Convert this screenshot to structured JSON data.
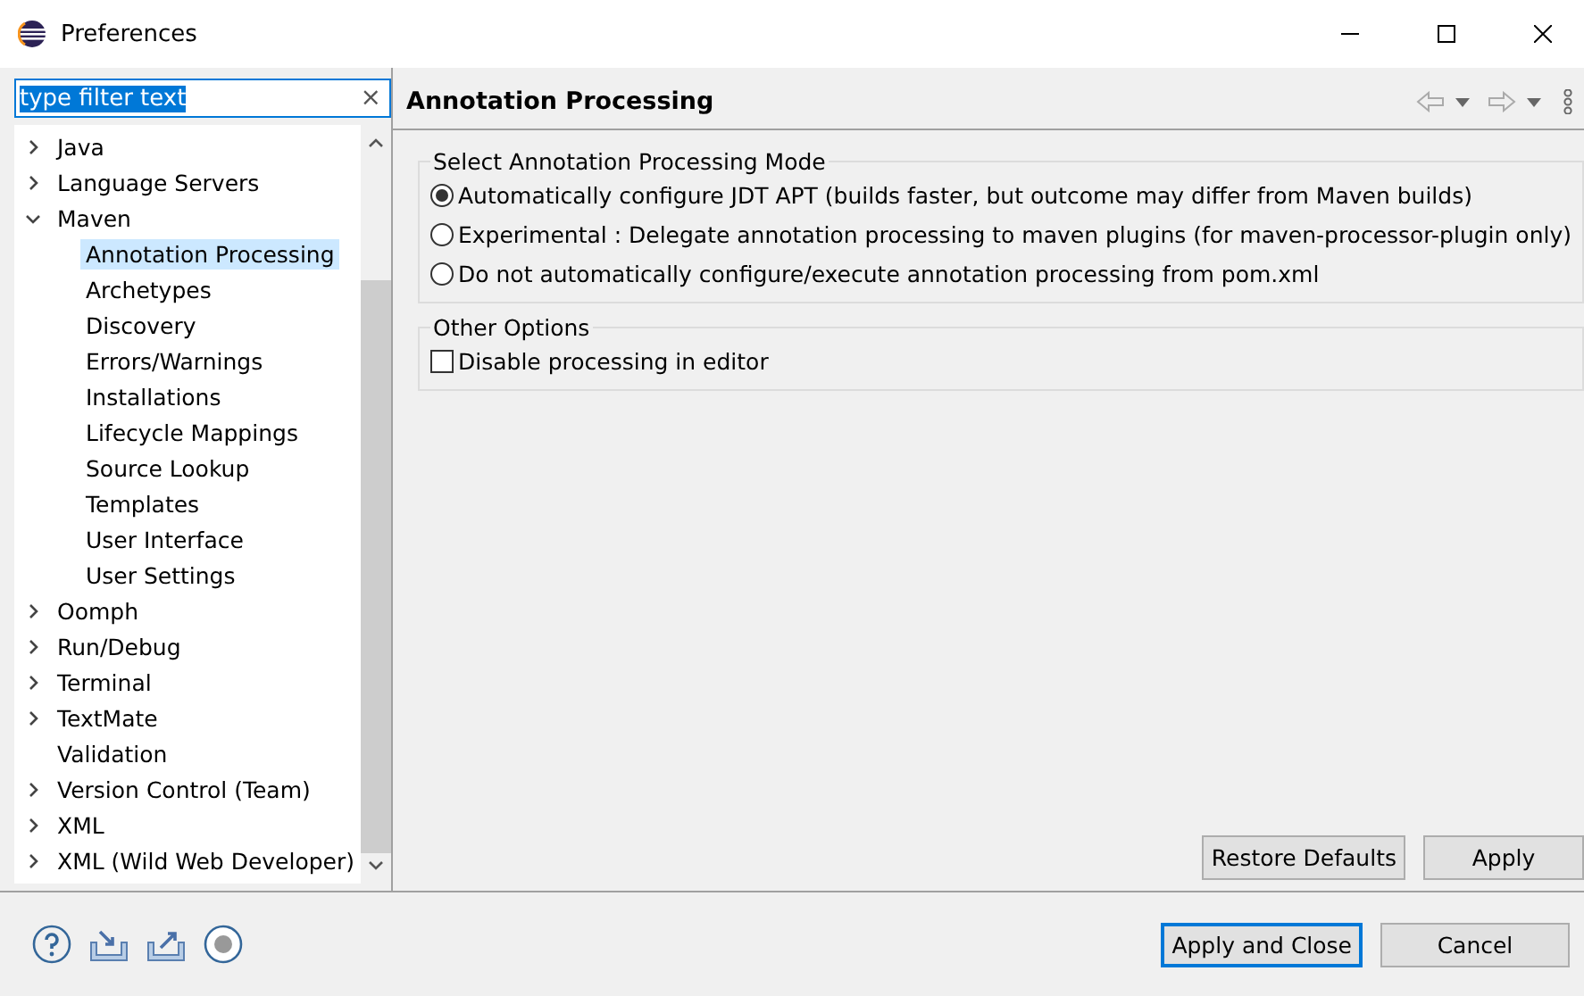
{
  "window": {
    "title": "Preferences"
  },
  "filter": {
    "value": "type filter text",
    "clear": "×"
  },
  "tree": [
    {
      "label": "Java",
      "expanded": false,
      "selected": false
    },
    {
      "label": "Language Servers",
      "expanded": false,
      "selected": false
    },
    {
      "label": "Maven",
      "expanded": true,
      "selected": false,
      "children": [
        {
          "label": "Annotation Processing",
          "selected": true
        },
        {
          "label": "Archetypes",
          "selected": false
        },
        {
          "label": "Discovery",
          "selected": false
        },
        {
          "label": "Errors/Warnings",
          "selected": false
        },
        {
          "label": "Installations",
          "selected": false
        },
        {
          "label": "Lifecycle Mappings",
          "selected": false
        },
        {
          "label": "Source Lookup",
          "selected": false
        },
        {
          "label": "Templates",
          "selected": false
        },
        {
          "label": "User Interface",
          "selected": false
        },
        {
          "label": "User Settings",
          "selected": false
        }
      ]
    },
    {
      "label": "Oomph",
      "expanded": false,
      "selected": false
    },
    {
      "label": "Run/Debug",
      "expanded": false,
      "selected": false
    },
    {
      "label": "Terminal",
      "expanded": false,
      "selected": false
    },
    {
      "label": "TextMate",
      "expanded": false,
      "selected": false
    },
    {
      "label": "Validation",
      "selected": false
    },
    {
      "label": "Version Control (Team)",
      "expanded": false,
      "selected": false
    },
    {
      "label": "XML",
      "expanded": false,
      "selected": false
    },
    {
      "label": "XML (Wild Web Developer)",
      "expanded": false,
      "selected": false
    }
  ],
  "page": {
    "title": "Annotation Processing",
    "groups": [
      {
        "title": "Select Annotation Processing Mode",
        "options": [
          {
            "kind": "radio",
            "label": "Automatically configure JDT APT (builds faster, but outcome may differ from Maven builds)",
            "selected": true
          },
          {
            "kind": "radio",
            "label": "Experimental : Delegate annotation processing to maven plugins (for maven-processor-plugin only)",
            "selected": false
          },
          {
            "kind": "radio",
            "label": "Do not automatically configure/execute annotation processing from pom.xml",
            "selected": false
          }
        ]
      },
      {
        "title": "Other Options",
        "options": [
          {
            "kind": "checkbox",
            "label": "Disable processing in editor",
            "checked": false
          }
        ]
      }
    ],
    "buttons": [
      "Restore Defaults",
      "Apply"
    ]
  },
  "footer_buttons": [
    {
      "label": "Apply and Close",
      "default": true
    },
    {
      "label": "Cancel",
      "default": false
    }
  ]
}
